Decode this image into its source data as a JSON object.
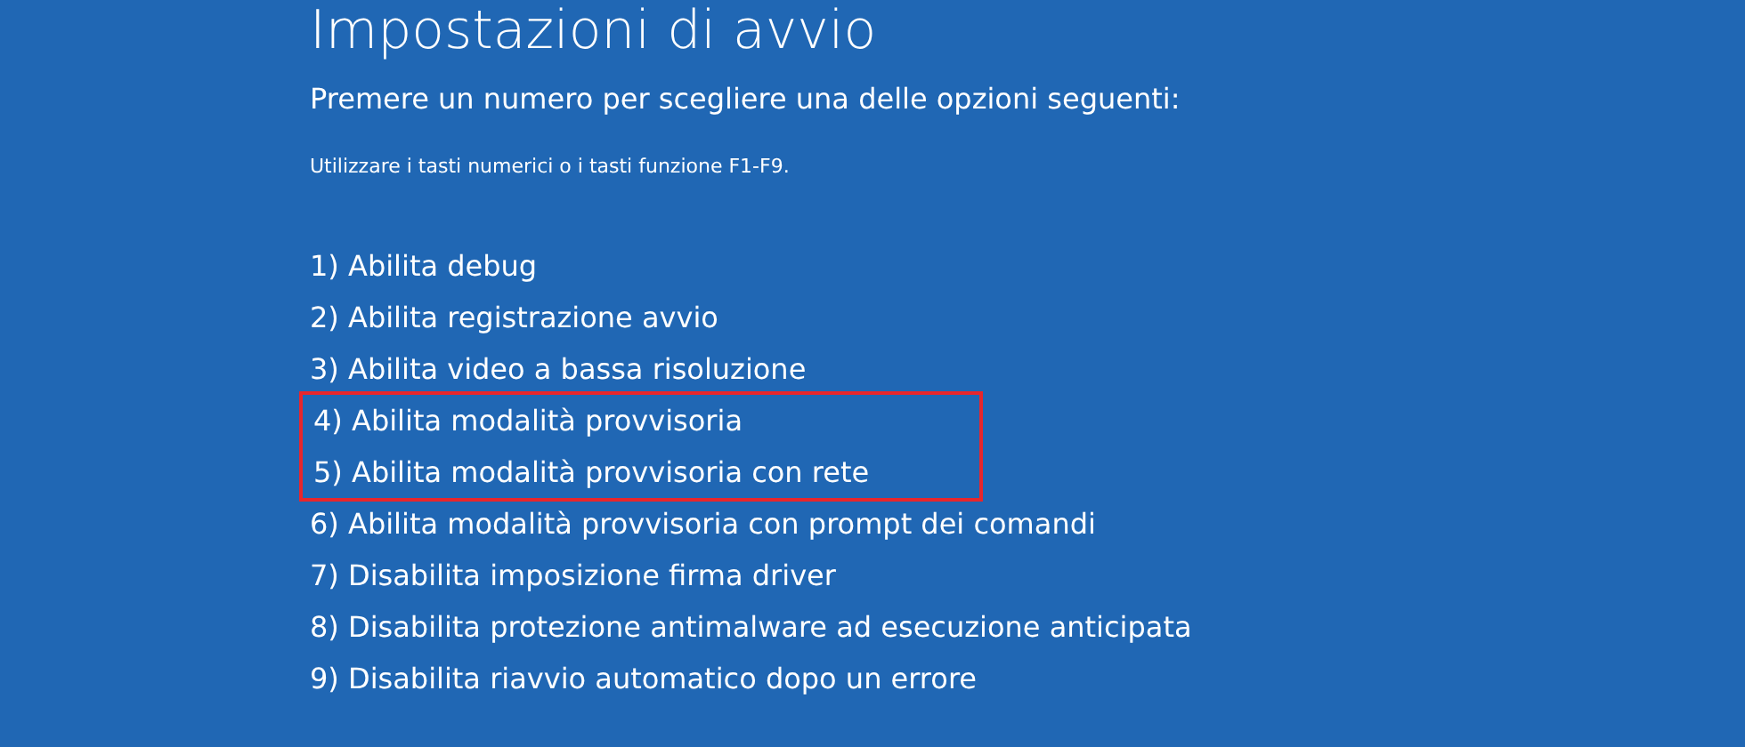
{
  "title": "Impostazioni di avvio",
  "prompt": "Premere un numero per scegliere una delle opzioni seguenti:",
  "hint": "Utilizzare i tasti numerici o i tasti funzione F1-F9.",
  "options": [
    {
      "label": "1) Abilita debug",
      "highlighted": false
    },
    {
      "label": "2) Abilita registrazione avvio",
      "highlighted": false
    },
    {
      "label": "3) Abilita video a bassa risoluzione",
      "highlighted": false
    },
    {
      "label": "4) Abilita modalità provvisoria",
      "highlighted": true
    },
    {
      "label": "5) Abilita modalità provvisoria con rete",
      "highlighted": true
    },
    {
      "label": "6) Abilita modalità provvisoria con prompt dei comandi",
      "highlighted": false
    },
    {
      "label": "7) Disabilita imposizione firma driver",
      "highlighted": false
    },
    {
      "label": "8) Disabilita protezione antimalware ad esecuzione anticipata",
      "highlighted": false
    },
    {
      "label": "9) Disabilita riavvio automatico dopo un errore",
      "highlighted": false
    }
  ]
}
